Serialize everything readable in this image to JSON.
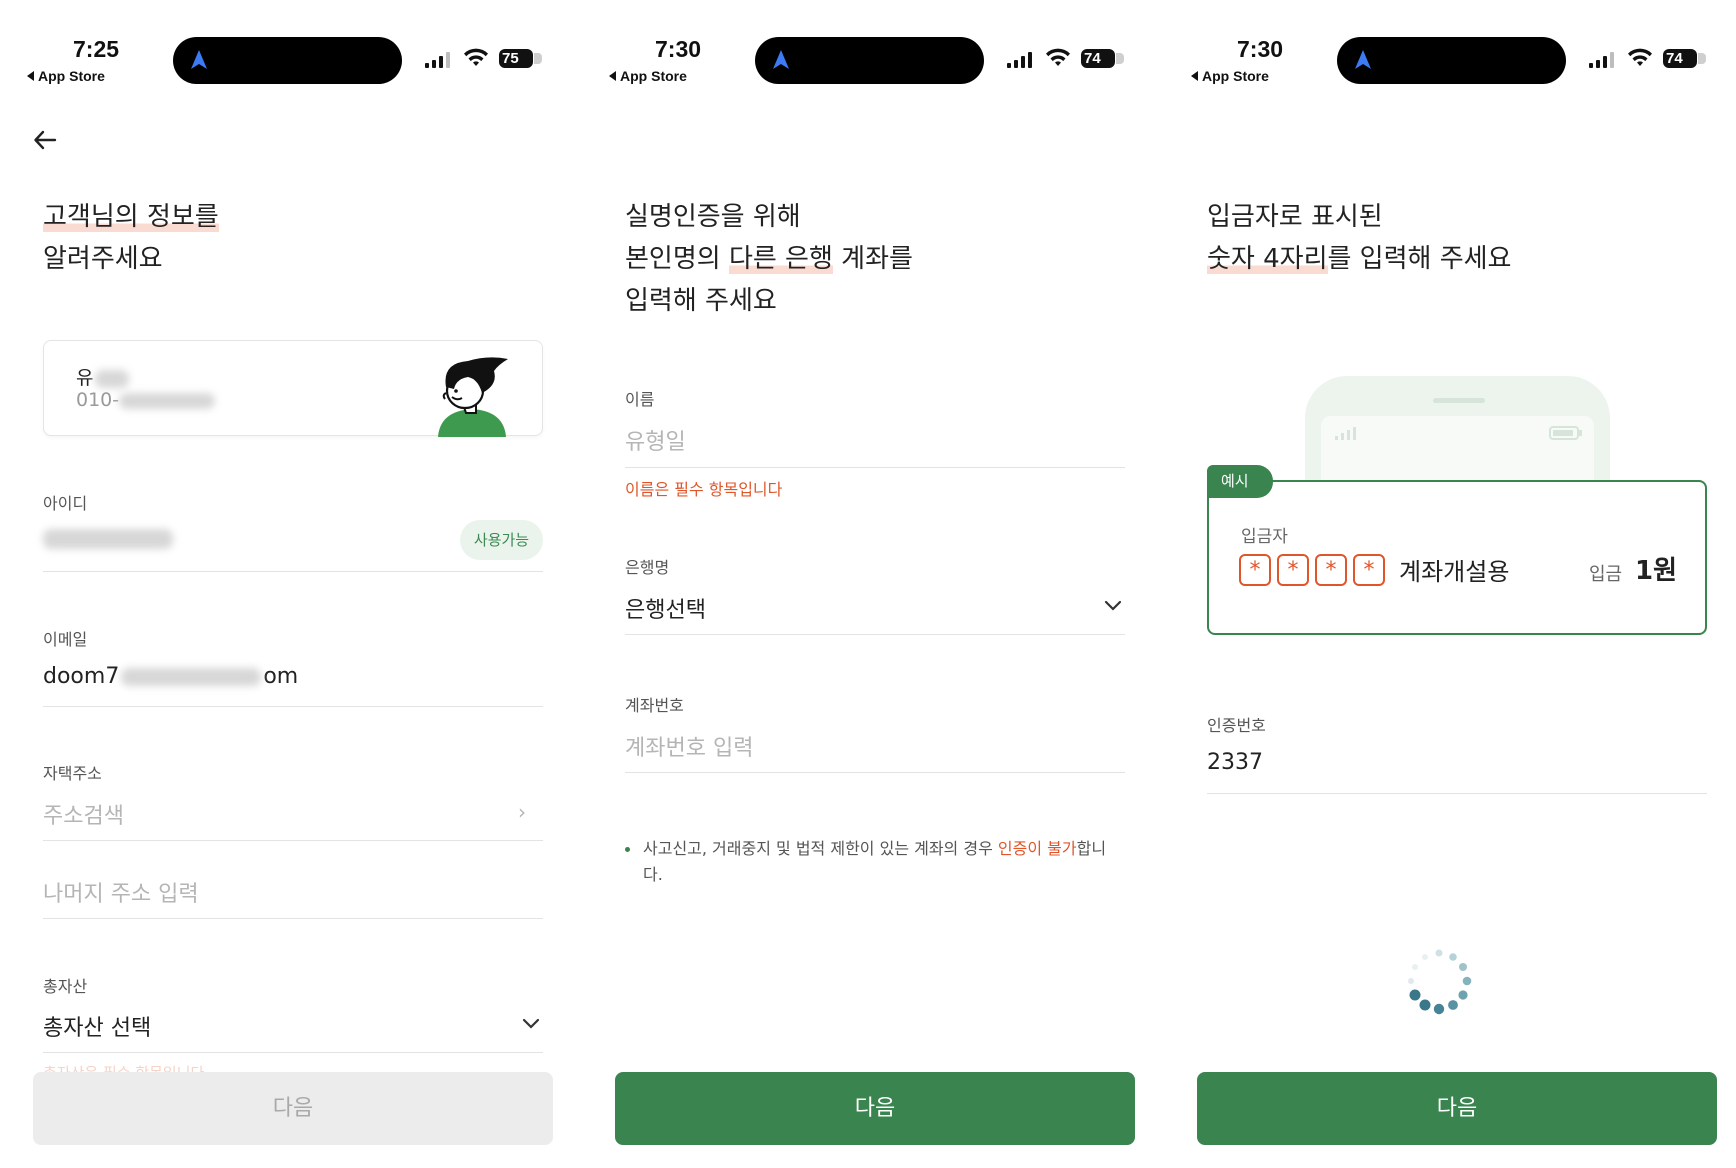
{
  "status_bars": [
    {
      "time": "7:25",
      "back_label": "App Store",
      "battery": "75"
    },
    {
      "time": "7:30",
      "back_label": "App Store",
      "battery": "74"
    },
    {
      "time": "7:30",
      "back_label": "App Store",
      "battery": "74"
    }
  ],
  "screen1": {
    "headline_hl": "고객님의 정보를",
    "headline_rest": "알려주세요",
    "profile": {
      "name_prefix": "유",
      "phone_prefix": "010-"
    },
    "id_label": "아이디",
    "id_badge": "사용가능",
    "email_label": "이메일",
    "email_prefix": "doom7",
    "email_suffix": "om",
    "address_label": "자택주소",
    "address_placeholder": "주소검색",
    "address_detail_placeholder": "나머지 주소 입력",
    "assets_label": "총자산",
    "assets_value": "총자산 선택",
    "assets_error": "총자산은 필수 항목입니다",
    "next_button": "다음"
  },
  "screen2": {
    "headline_line1": "실명인증을 위해",
    "headline_line2_plain": "본인명의 ",
    "headline_line2_hl": "다른 은행",
    "headline_line2_rest": " 계좌를",
    "headline_line3": "입력해 주세요",
    "name_label": "이름",
    "name_value": "유형일",
    "name_error": "이름은 필수 항목입니다",
    "bank_label": "은행명",
    "bank_value": "은행선택",
    "account_label": "계좌번호",
    "account_placeholder": "계좌번호 입력",
    "notice_prefix": "사고신고, 거래중지 및 법적 제한이 있는 계좌의 경우 ",
    "notice_red": "인증이 불가",
    "notice_suffix": "합니다.",
    "next_button": "다음"
  },
  "screen3": {
    "headline_line1": "입금자로 표시된",
    "headline_hl": "숫자 4자리",
    "headline_rest": "를 입력해 주세요",
    "example_tag": "예시",
    "depositor_label": "입금자",
    "masked_digit": "*",
    "memo": "계좌개설용",
    "amount_label": "입금",
    "amount_value": "1원",
    "code_label": "인증번호",
    "code_value": "2337",
    "next_button": "다음"
  },
  "colors": {
    "primary_green": "#3a844f",
    "error_orange": "#e0562b",
    "highlight": "#f9dbd2"
  }
}
